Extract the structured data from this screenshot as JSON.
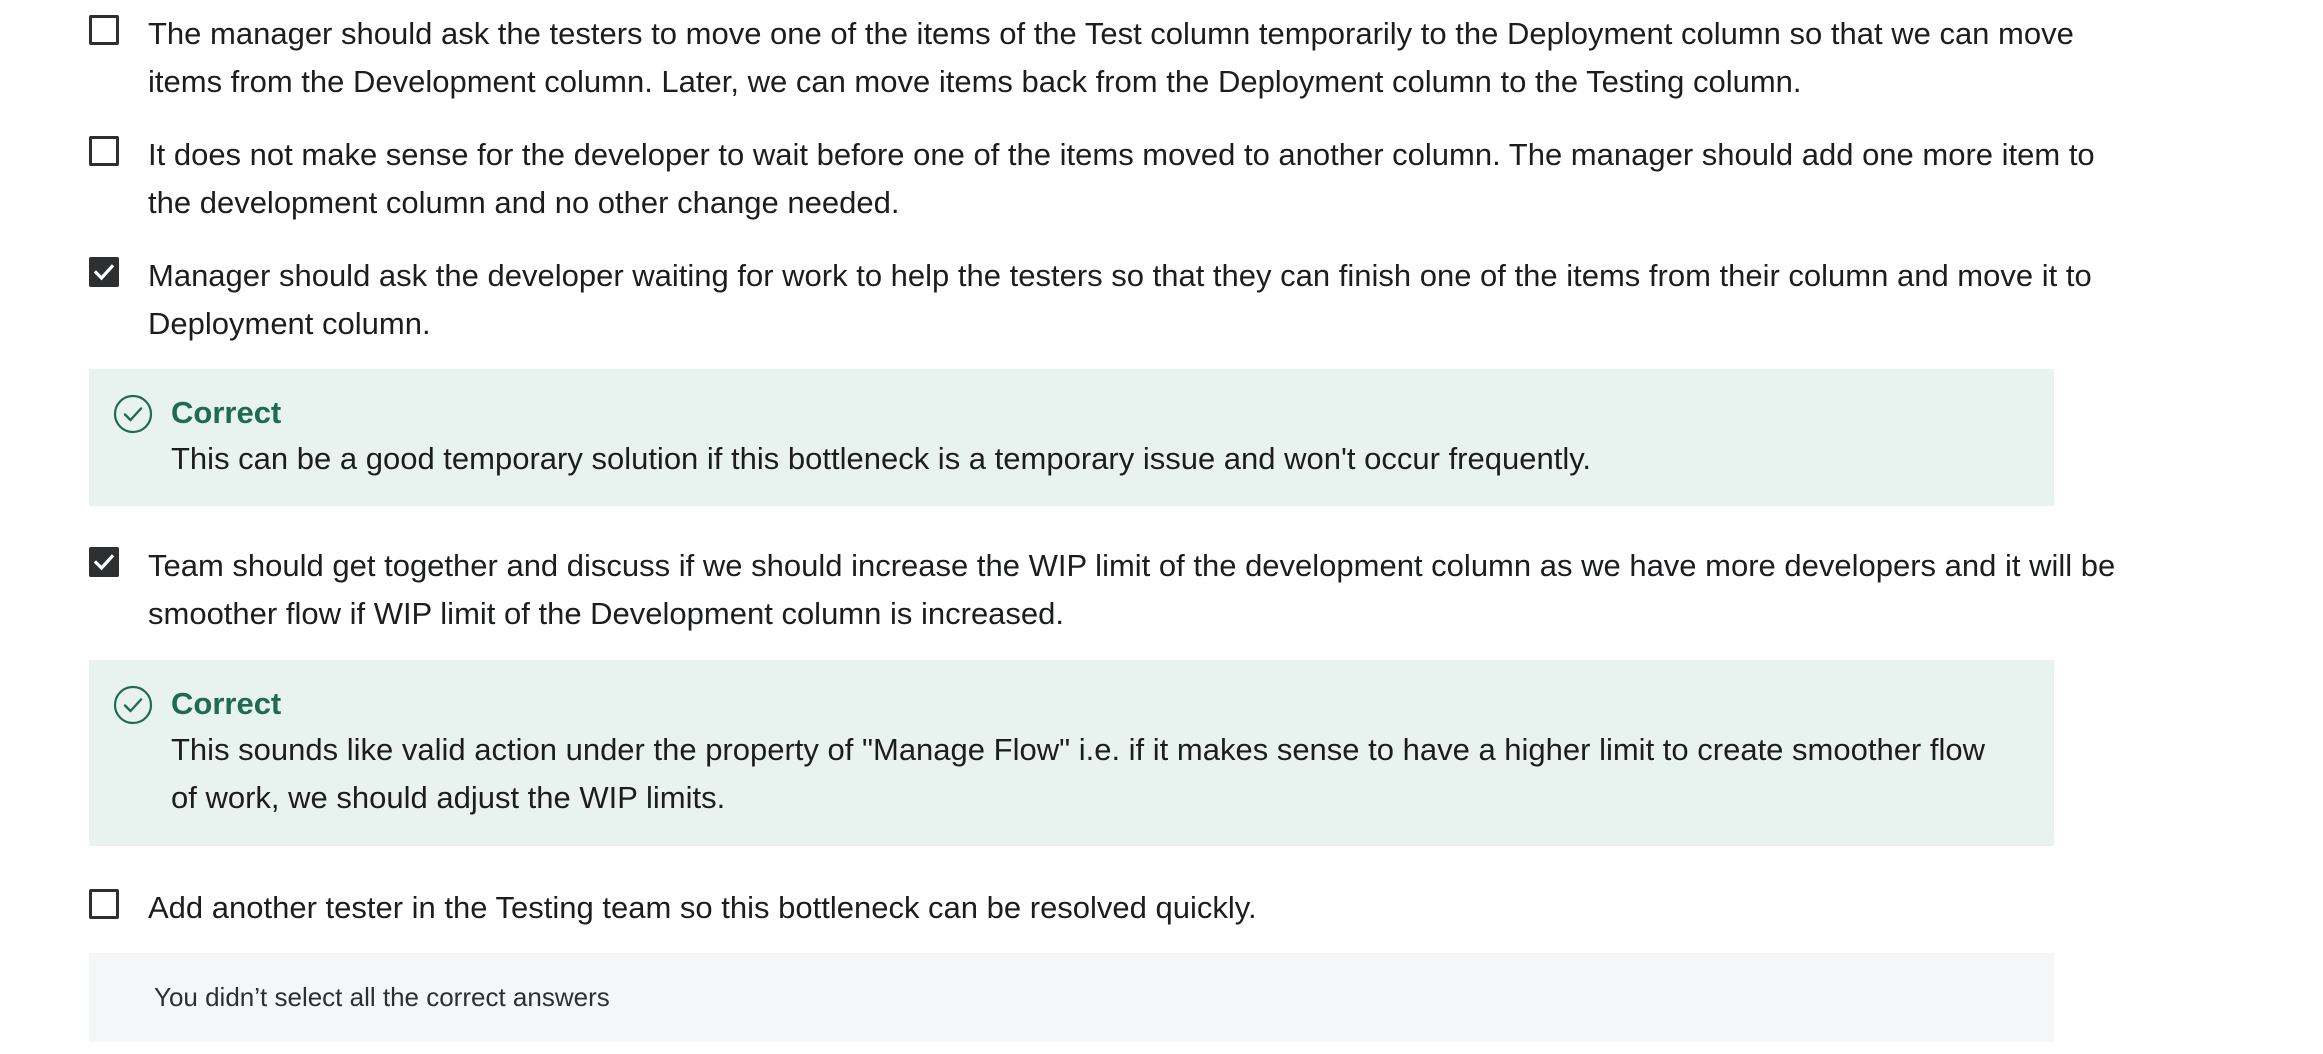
{
  "options": [
    {
      "text": "The manager should ask the testers to move one of the items of the Test column temporarily to the Deployment column so that we can move items from the Development column. Later, we can move items back from the Deployment column to the Testing column.",
      "checked": false
    },
    {
      "text": "It does not make sense for the developer to wait before one of the items moved to another column. The manager should add one more item to the development column and no other change needed.",
      "checked": false
    },
    {
      "text": "Manager should ask the developer waiting for work to help the testers so that they can finish one of the items from their column and move it to Deployment column.",
      "checked": true
    },
    {
      "text": "Team should get together and discuss if we should increase the WIP limit of the development column as we have more developers and it will be smoother flow if WIP limit of the Development column is increased.",
      "checked": true
    },
    {
      "text": "Add another tester in the Testing team so this bottleneck can be resolved quickly.",
      "checked": false
    }
  ],
  "feedback": [
    {
      "title": "Correct",
      "text": "This can be a good temporary solution if this bottleneck is a temporary issue and won't occur frequently."
    },
    {
      "title": "Correct",
      "text": "This sounds like valid action under the property of \"Manage Flow\" i.e. if it makes sense to have a higher limit to create smoother flow of work, we should adjust the WIP limits."
    }
  ],
  "result": {
    "message": "You didn’t select all the correct answers"
  },
  "icons": {
    "checkbox_checked": "check-icon",
    "feedback": "check-circle-icon"
  },
  "colors": {
    "correct_green": "#1e6b52",
    "feedback_bg": "#e8f2ee",
    "checkbox": "#2d2f31",
    "result_bg": "#f5f6f7"
  }
}
